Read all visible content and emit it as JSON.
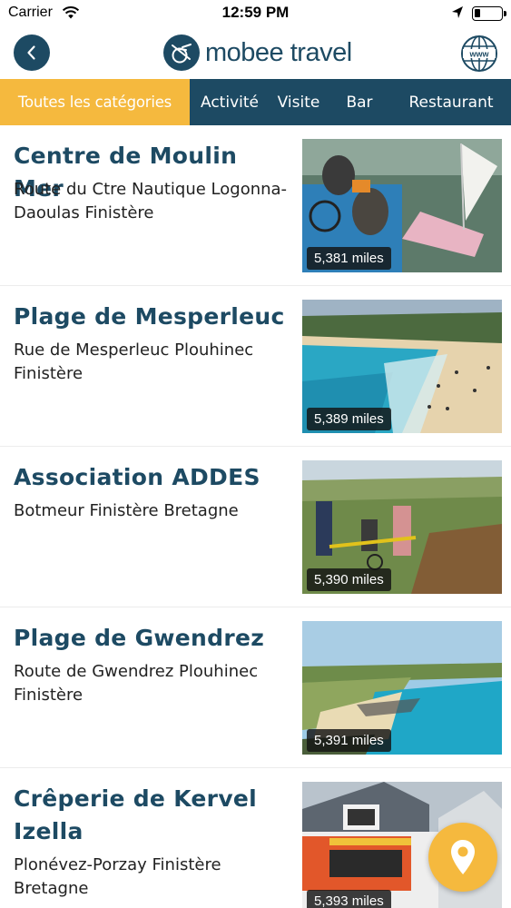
{
  "status_bar": {
    "carrier": "Carrier",
    "time": "12:59 PM"
  },
  "header": {
    "brand": "mobee travel",
    "back_icon": "chevron-left-icon",
    "web_icon": "globe-www-icon"
  },
  "colors": {
    "primary": "#1d4a63",
    "accent": "#f5b93e"
  },
  "categories": [
    {
      "label": "Toutes les catégories",
      "active": true
    },
    {
      "label": "Activité",
      "active": false
    },
    {
      "label": "Visite",
      "active": false
    },
    {
      "label": "Bar",
      "active": false
    },
    {
      "label": "Restaurant",
      "active": false
    }
  ],
  "places": [
    {
      "title": "Centre de Moulin Mer",
      "address": "Route du Ctre Nautique Logonna-Daoulas Finistère",
      "distance": "5,381 miles"
    },
    {
      "title": "Plage de Mesperleuc",
      "address": "Rue de Mesperleuc Plouhinec Finistère",
      "distance": "5,389 miles"
    },
    {
      "title": "Association ADDES",
      "address": "Botmeur Finistère Bretagne",
      "distance": "5,390 miles"
    },
    {
      "title": "Plage de Gwendrez",
      "address": "Route de Gwendrez Plouhinec Finistère",
      "distance": "5,391 miles"
    },
    {
      "title": "Crêperie de Kervel Izella",
      "address": "Plonévez-Porzay Finistère Bretagne",
      "distance": "5,393 miles"
    }
  ],
  "map_button": {
    "icon": "map-pin-icon"
  }
}
